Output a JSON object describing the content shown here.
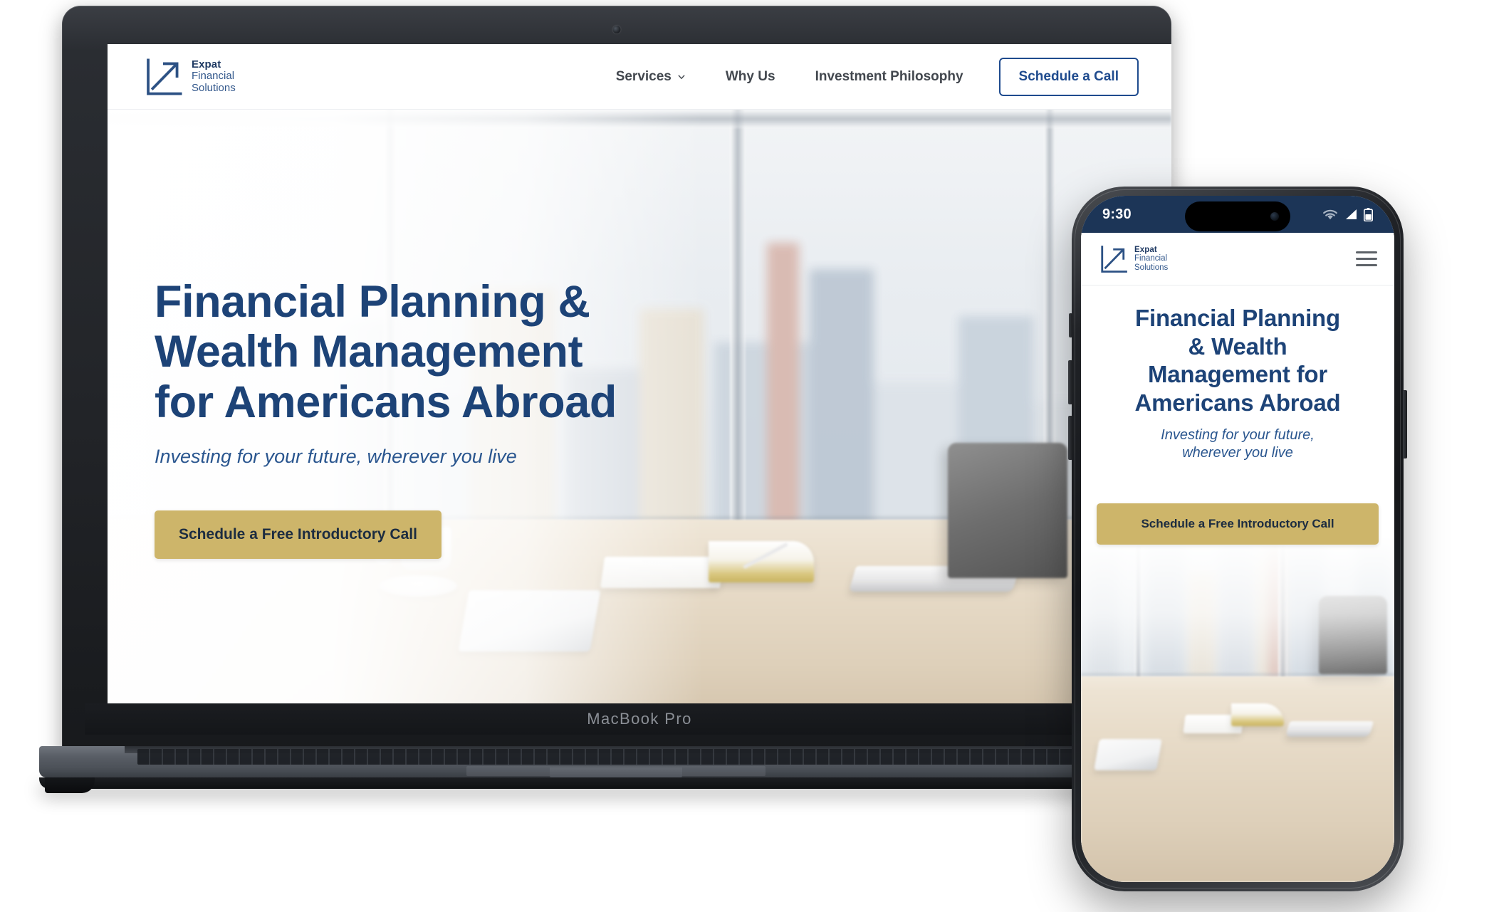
{
  "brand": {
    "line1": "Expat",
    "line2": "Financial",
    "line3": "Solutions",
    "logo_icon": "diagonal-arrow-square-icon",
    "navy": "#1d4377",
    "gold": "#cdb56a"
  },
  "desktop": {
    "device_label": "MacBook Pro",
    "nav": {
      "items": [
        {
          "label": "Services",
          "has_dropdown": true,
          "chevron_icon": "chevron-down-icon"
        },
        {
          "label": "Why Us",
          "has_dropdown": false
        },
        {
          "label": "Investment Philosophy",
          "has_dropdown": false
        }
      ],
      "cta_label": "Schedule a Call"
    },
    "hero": {
      "title_lines": [
        "Financial Planning &",
        "Wealth Management",
        "for Americans Abroad"
      ],
      "subtitle": "Investing for your future, wherever you live",
      "cta_label": "Schedule a Free Introductory Call",
      "background_description": "Blurred office desk with coffee cup, tablet, open notebook and laptop in front of a floor-to-ceiling window overlooking a city skyline"
    }
  },
  "phone": {
    "status_bar": {
      "time": "9:30",
      "background": "#1c3557",
      "icons": [
        "wifi-icon",
        "cellular-signal-icon",
        "battery-icon"
      ]
    },
    "header": {
      "menu_icon": "hamburger-menu-icon"
    },
    "hero": {
      "title_lines": [
        "Financial Planning",
        "& Wealth",
        "Management for",
        "Americans Abroad"
      ],
      "subtitle_lines": [
        "Investing for your future,",
        "wherever you live"
      ],
      "cta_label": "Schedule a Free Introductory Call"
    }
  }
}
